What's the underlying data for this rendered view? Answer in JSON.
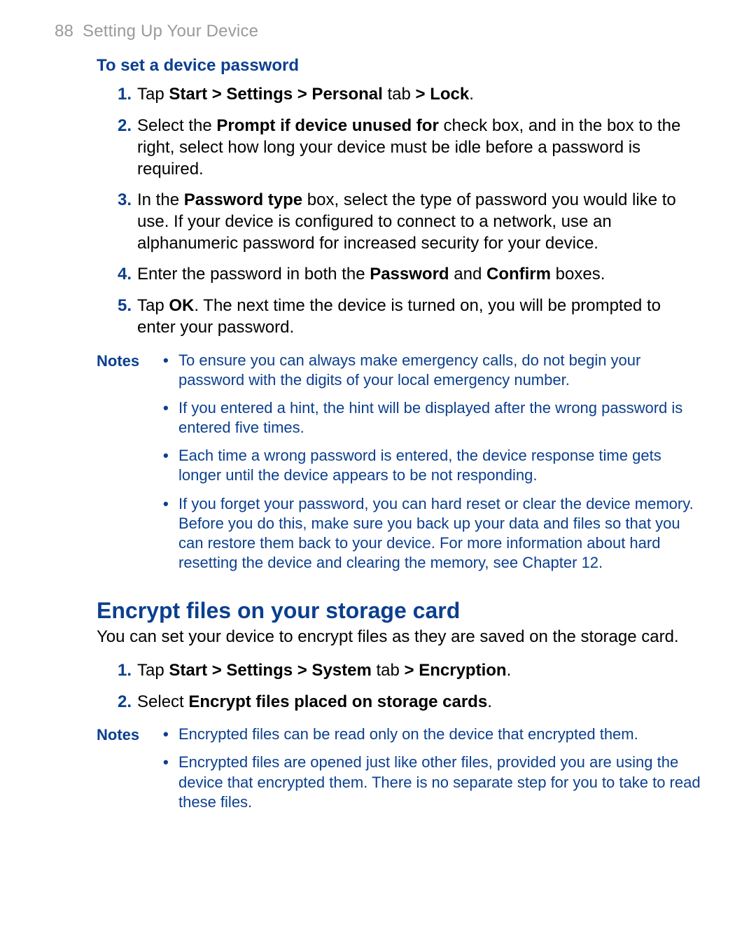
{
  "pageNumber": "88",
  "chapterTitle": "Setting Up Your Device",
  "proc1": {
    "title": "To set a device password",
    "steps": [
      {
        "n": "1.",
        "segs": [
          "Tap ",
          {
            "b": "Start > Settings > Personal"
          },
          " tab ",
          {
            "b": "> Lock"
          },
          "."
        ]
      },
      {
        "n": "2.",
        "segs": [
          "Select the ",
          {
            "b": "Prompt if device unused for"
          },
          " check box, and in the box to the right, select how long your device must be idle before a password is required."
        ]
      },
      {
        "n": "3.",
        "segs": [
          "In the ",
          {
            "b": "Password type"
          },
          " box, select the type of password you would like to use. If your device is configured to connect to a network, use an alphanumeric password for increased security for your device."
        ]
      },
      {
        "n": "4.",
        "segs": [
          "Enter the password in both the ",
          {
            "b": "Password"
          },
          " and ",
          {
            "b": "Confirm"
          },
          " boxes."
        ]
      },
      {
        "n": "5.",
        "segs": [
          "Tap ",
          {
            "b": "OK"
          },
          ". The next time the device is turned on, you will be prompted to enter your password."
        ]
      }
    ]
  },
  "notes1": {
    "label": "Notes",
    "items": [
      "To ensure you can always make emergency calls, do not begin your password with the digits of your local emergency number.",
      "If you entered a hint, the hint will be displayed after the wrong password is entered five times.",
      "Each time a wrong password is entered, the device response time gets longer until the device appears to be not responding.",
      "If you forget your password, you can hard reset or clear the device memory. Before you do this, make sure you back up your data and files so that you can restore them back to your device. For more information about hard resetting the device and clearing the memory, see Chapter 12."
    ]
  },
  "section2": {
    "title": "Encrypt files on your storage card",
    "intro": "You can set your device to encrypt files as they are saved on the storage card."
  },
  "proc2": {
    "steps": [
      {
        "n": "1.",
        "segs": [
          "Tap ",
          {
            "b": "Start > Settings > System"
          },
          " tab ",
          {
            "b": "> Encryption"
          },
          "."
        ]
      },
      {
        "n": "2.",
        "segs": [
          "Select ",
          {
            "b": "Encrypt files placed on storage cards"
          },
          "."
        ]
      }
    ]
  },
  "notes2": {
    "label": "Notes",
    "items": [
      "Encrypted files can be read only on the device that encrypted them.",
      "Encrypted files are opened just like other files, provided you are using the device that encrypted them. There is no separate step for you to take to read these files."
    ]
  }
}
